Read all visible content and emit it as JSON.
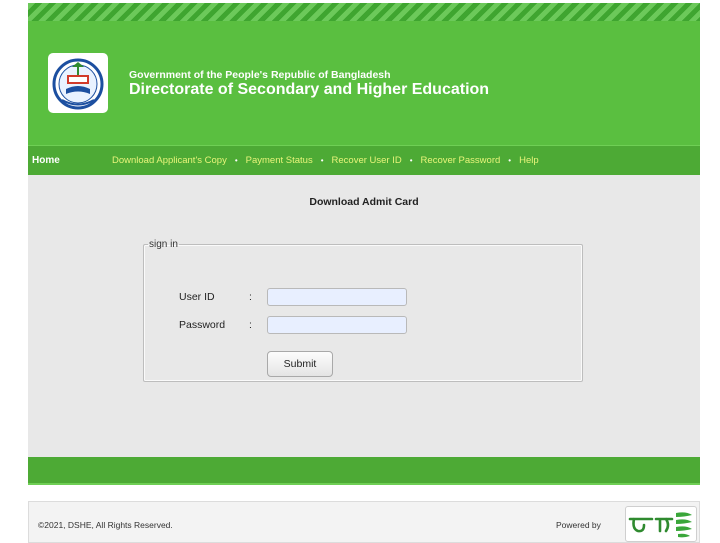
{
  "header": {
    "gov_title": "Government of the People's Republic of Bangladesh",
    "dir_title": "Directorate of Secondary and Higher Education",
    "logo_icon": "dshe-emblem-icon"
  },
  "nav": {
    "home": "Home",
    "items": [
      {
        "label": "Download Applicant's Copy"
      },
      {
        "label": "Payment Status"
      },
      {
        "label": "Recover User ID"
      },
      {
        "label": "Recover Password"
      },
      {
        "label": "Help"
      }
    ],
    "separator": "•"
  },
  "main": {
    "heading": "Download Admit Card",
    "legend": "sign in",
    "userid_label": "User ID",
    "password_label": "Password",
    "colon": ":",
    "userid_value": "",
    "password_value": "",
    "submit_label": "Submit"
  },
  "footer": {
    "copyright": "©2021, DSHE, All Rights Reserved.",
    "powered_by": "Powered by",
    "partner_icon": "teletalk-logo-icon"
  },
  "colors": {
    "header_green": "#5abf40",
    "nav_green": "#4daa35",
    "nav_link": "#e8f47a",
    "content_bg": "#e8e8e8",
    "input_bg": "#e8efff"
  }
}
